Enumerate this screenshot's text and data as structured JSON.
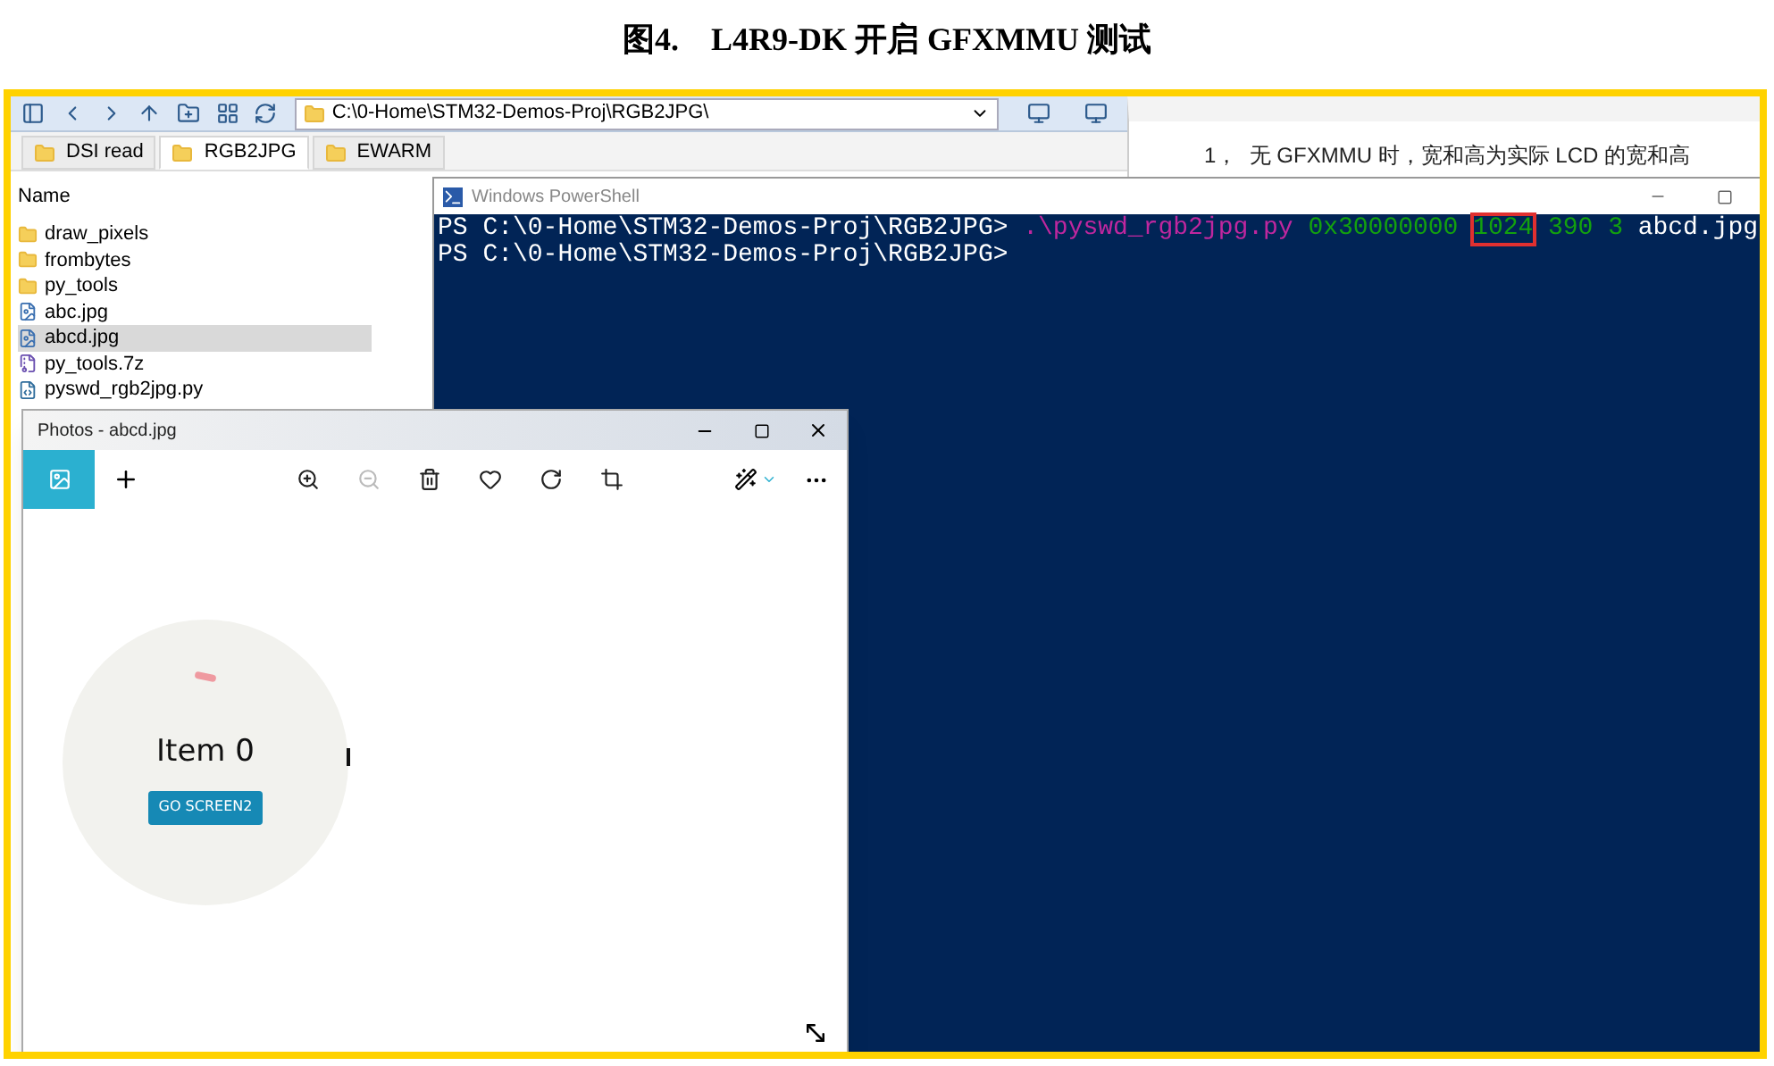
{
  "figure_caption": "图4.    L4R9-DK 开启 GFXMMU 测试",
  "explorer": {
    "address": "C:\\0-Home\\STM32-Demos-Proj\\RGB2JPG\\",
    "tabs": [
      {
        "label": "DSI read",
        "selected": false
      },
      {
        "label": "RGB2JPG",
        "selected": true
      },
      {
        "label": "EWARM",
        "selected": false
      }
    ],
    "column_header": "Name",
    "files": [
      {
        "name": "draw_pixels",
        "kind": "folder",
        "selected": false
      },
      {
        "name": "frombytes",
        "kind": "folder",
        "selected": false
      },
      {
        "name": "py_tools",
        "kind": "folder",
        "selected": false
      },
      {
        "name": "abc.jpg",
        "kind": "image",
        "selected": false
      },
      {
        "name": "abcd.jpg",
        "kind": "image",
        "selected": true
      },
      {
        "name": "py_tools.7z",
        "kind": "archive",
        "selected": false
      },
      {
        "name": "pyswd_rgb2jpg.py",
        "kind": "python",
        "selected": false
      }
    ]
  },
  "document": {
    "line": "1，  无 GFXMMU 时，宽和高为实际 LCD 的宽和高"
  },
  "powershell": {
    "title": "Windows PowerShell",
    "lines": [
      {
        "tokens": [
          {
            "text": "PS C:\\0-Home\\STM32-Demos-Proj\\RGB2JPG>",
            "kind": "prompt"
          },
          {
            "text": ".\\pyswd_rgb2jpg.py",
            "kind": "command"
          },
          {
            "text": "0x30000000",
            "kind": "argument"
          },
          {
            "text": "1024",
            "kind": "highlighted"
          },
          {
            "text": "390",
            "kind": "argument"
          },
          {
            "text": "3",
            "kind": "argument"
          },
          {
            "text": "abcd.jpg",
            "kind": "plain"
          }
        ]
      },
      {
        "tokens": [
          {
            "text": "PS C:\\0-Home\\STM32-Demos-Proj\\RGB2JPG>",
            "kind": "prompt"
          }
        ]
      }
    ]
  },
  "photos": {
    "title": "Photos - abcd.jpg",
    "tools": [
      {
        "kind": "zoom-in",
        "disabled": false
      },
      {
        "kind": "zoom-out",
        "disabled": true
      },
      {
        "kind": "delete",
        "disabled": false
      },
      {
        "kind": "favorite",
        "disabled": false
      },
      {
        "kind": "rotate",
        "disabled": false
      },
      {
        "kind": "crop",
        "disabled": false
      }
    ],
    "image": {
      "label": "Item 0",
      "button": "GO SCREEN2"
    }
  }
}
